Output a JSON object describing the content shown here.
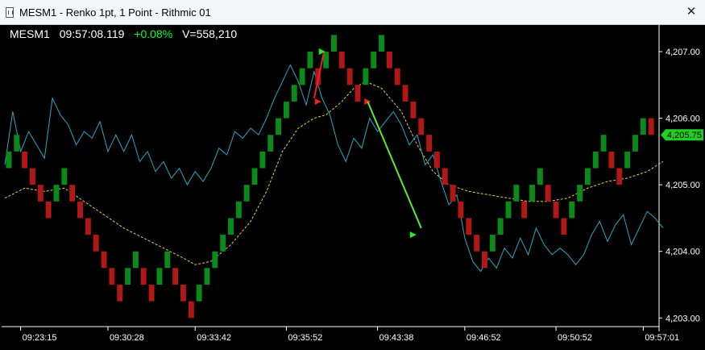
{
  "window": {
    "title": "MESM1 - Renko 1pt, 1 Point - Rithmic 01",
    "close_icon": "close-icon",
    "close_glyph": "✕"
  },
  "info": {
    "symbol": "MESM1",
    "time": "09:57:08.119",
    "change": "+0.08%",
    "volume": "V=558,210"
  },
  "colors": {
    "up": "#0a8a1a",
    "down": "#b01717",
    "fast_line": "#2aa6c4",
    "slow_line": "#e8d33a",
    "arrow_green": "#22ee22",
    "arrow_red": "#ee2222",
    "trend_line": "#55ee33",
    "last_price_bg": "#22cc22",
    "axis": "#ffffff"
  },
  "chart_data": {
    "type": "renko",
    "y_axis": {
      "ylim": [
        4202.87,
        4207.4
      ],
      "ticks": [
        "4,203.00",
        "4,204.00",
        "4,205.00",
        "4,206.00",
        "4,207.00"
      ],
      "tick_values": [
        4203,
        4204,
        4205,
        4206,
        4207
      ]
    },
    "x_axis": {
      "xlim": [
        0,
        165
      ],
      "ticks": [
        "09:23:15",
        "09:30:28",
        "09:33:42",
        "09:35:52",
        "09:43:38",
        "09:46:52",
        "09:50:52",
        "09:57:01"
      ],
      "tick_positions": [
        4,
        26,
        48,
        71,
        94,
        116,
        139,
        161
      ]
    },
    "last_price": "4,205.75",
    "last_price_value": 4205.75,
    "bricks": [
      {
        "x": 1,
        "lo": 4205.25,
        "up": true
      },
      {
        "x": 3,
        "lo": 4205.5,
        "up": true
      },
      {
        "x": 5,
        "lo": 4205.25,
        "up": false
      },
      {
        "x": 7,
        "lo": 4205.0,
        "up": false
      },
      {
        "x": 9,
        "lo": 4204.75,
        "up": false
      },
      {
        "x": 11,
        "lo": 4204.5,
        "up": false
      },
      {
        "x": 13,
        "lo": 4204.75,
        "up": true
      },
      {
        "x": 15,
        "lo": 4205.0,
        "up": true
      },
      {
        "x": 17,
        "lo": 4204.75,
        "up": false
      },
      {
        "x": 19,
        "lo": 4204.5,
        "up": false
      },
      {
        "x": 21,
        "lo": 4204.25,
        "up": false
      },
      {
        "x": 23,
        "lo": 4204.0,
        "up": false
      },
      {
        "x": 25,
        "lo": 4203.75,
        "up": false
      },
      {
        "x": 27,
        "lo": 4203.5,
        "up": false
      },
      {
        "x": 29,
        "lo": 4203.25,
        "up": false
      },
      {
        "x": 31,
        "lo": 4203.5,
        "up": true
      },
      {
        "x": 33,
        "lo": 4203.75,
        "up": true
      },
      {
        "x": 35,
        "lo": 4203.5,
        "up": false
      },
      {
        "x": 37,
        "lo": 4203.25,
        "up": false
      },
      {
        "x": 39,
        "lo": 4203.5,
        "up": true
      },
      {
        "x": 41,
        "lo": 4203.75,
        "up": true
      },
      {
        "x": 43,
        "lo": 4203.5,
        "up": false
      },
      {
        "x": 45,
        "lo": 4203.25,
        "up": false
      },
      {
        "x": 47,
        "lo": 4203.0,
        "up": false
      },
      {
        "x": 49,
        "lo": 4203.25,
        "up": true
      },
      {
        "x": 51,
        "lo": 4203.5,
        "up": true
      },
      {
        "x": 53,
        "lo": 4203.75,
        "up": true
      },
      {
        "x": 55,
        "lo": 4204.0,
        "up": true
      },
      {
        "x": 57,
        "lo": 4204.25,
        "up": true
      },
      {
        "x": 59,
        "lo": 4204.5,
        "up": true
      },
      {
        "x": 61,
        "lo": 4204.75,
        "up": true
      },
      {
        "x": 63,
        "lo": 4205.0,
        "up": true
      },
      {
        "x": 65,
        "lo": 4205.25,
        "up": true
      },
      {
        "x": 67,
        "lo": 4205.5,
        "up": true
      },
      {
        "x": 69,
        "lo": 4205.75,
        "up": true
      },
      {
        "x": 71,
        "lo": 4206.0,
        "up": true
      },
      {
        "x": 73,
        "lo": 4206.25,
        "up": true
      },
      {
        "x": 75,
        "lo": 4206.5,
        "up": true
      },
      {
        "x": 77,
        "lo": 4206.75,
        "up": true
      },
      {
        "x": 79,
        "lo": 4206.5,
        "up": false
      },
      {
        "x": 81,
        "lo": 4206.75,
        "up": true
      },
      {
        "x": 83,
        "lo": 4207.0,
        "up": true
      },
      {
        "x": 85,
        "lo": 4206.75,
        "up": false
      },
      {
        "x": 87,
        "lo": 4206.5,
        "up": false
      },
      {
        "x": 89,
        "lo": 4206.25,
        "up": false
      },
      {
        "x": 91,
        "lo": 4206.5,
        "up": true
      },
      {
        "x": 93,
        "lo": 4206.75,
        "up": true
      },
      {
        "x": 95,
        "lo": 4207.0,
        "up": true
      },
      {
        "x": 97,
        "lo": 4206.75,
        "up": false
      },
      {
        "x": 99,
        "lo": 4206.5,
        "up": false
      },
      {
        "x": 101,
        "lo": 4206.25,
        "up": false
      },
      {
        "x": 103,
        "lo": 4206.0,
        "up": false
      },
      {
        "x": 105,
        "lo": 4205.75,
        "up": false
      },
      {
        "x": 107,
        "lo": 4205.5,
        "up": false
      },
      {
        "x": 109,
        "lo": 4205.25,
        "up": false
      },
      {
        "x": 111,
        "lo": 4205.0,
        "up": false
      },
      {
        "x": 113,
        "lo": 4204.75,
        "up": false
      },
      {
        "x": 115,
        "lo": 4204.5,
        "up": false
      },
      {
        "x": 117,
        "lo": 4204.25,
        "up": false
      },
      {
        "x": 119,
        "lo": 4204.0,
        "up": false
      },
      {
        "x": 121,
        "lo": 4203.75,
        "up": false
      },
      {
        "x": 123,
        "lo": 4204.0,
        "up": true
      },
      {
        "x": 125,
        "lo": 4204.25,
        "up": true
      },
      {
        "x": 127,
        "lo": 4204.5,
        "up": true
      },
      {
        "x": 129,
        "lo": 4204.75,
        "up": true
      },
      {
        "x": 131,
        "lo": 4204.5,
        "up": false
      },
      {
        "x": 133,
        "lo": 4204.75,
        "up": true
      },
      {
        "x": 135,
        "lo": 4205.0,
        "up": true
      },
      {
        "x": 137,
        "lo": 4204.75,
        "up": false
      },
      {
        "x": 139,
        "lo": 4204.5,
        "up": false
      },
      {
        "x": 141,
        "lo": 4204.25,
        "up": false
      },
      {
        "x": 143,
        "lo": 4204.5,
        "up": true
      },
      {
        "x": 145,
        "lo": 4204.75,
        "up": true
      },
      {
        "x": 147,
        "lo": 4205.0,
        "up": true
      },
      {
        "x": 149,
        "lo": 4205.25,
        "up": true
      },
      {
        "x": 151,
        "lo": 4205.5,
        "up": true
      },
      {
        "x": 153,
        "lo": 4205.25,
        "up": false
      },
      {
        "x": 155,
        "lo": 4205.0,
        "up": false
      },
      {
        "x": 157,
        "lo": 4205.25,
        "up": true
      },
      {
        "x": 159,
        "lo": 4205.5,
        "up": true
      },
      {
        "x": 161,
        "lo": 4205.75,
        "up": true
      },
      {
        "x": 163,
        "lo": 4205.75,
        "up": false
      }
    ],
    "fast_ma": [
      [
        0,
        4205.3
      ],
      [
        2,
        4206.1
      ],
      [
        4,
        4205.5
      ],
      [
        6,
        4205.8
      ],
      [
        8,
        4205.6
      ],
      [
        10,
        4205.4
      ],
      [
        12,
        4206.3
      ],
      [
        14,
        4206.05
      ],
      [
        16,
        4205.9
      ],
      [
        18,
        4205.6
      ],
      [
        20,
        4205.8
      ],
      [
        22,
        4205.7
      ],
      [
        24,
        4205.95
      ],
      [
        26,
        4205.5
      ],
      [
        28,
        4205.75
      ],
      [
        30,
        4205.5
      ],
      [
        32,
        4205.75
      ],
      [
        34,
        4205.35
      ],
      [
        36,
        4205.5
      ],
      [
        38,
        4205.2
      ],
      [
        40,
        4205.35
      ],
      [
        42,
        4205.1
      ],
      [
        44,
        4205.25
      ],
      [
        46,
        4205.0
      ],
      [
        48,
        4205.2
      ],
      [
        50,
        4205.05
      ],
      [
        52,
        4205.25
      ],
      [
        54,
        4205.55
      ],
      [
        56,
        4205.45
      ],
      [
        58,
        4205.8
      ],
      [
        60,
        4205.7
      ],
      [
        62,
        4205.85
      ],
      [
        64,
        4205.75
      ],
      [
        66,
        4206.0
      ],
      [
        68,
        4206.3
      ],
      [
        70,
        4206.55
      ],
      [
        72,
        4206.8
      ],
      [
        74,
        4206.55
      ],
      [
        76,
        4206.2
      ],
      [
        78,
        4206.7
      ],
      [
        80,
        4206.3
      ],
      [
        82,
        4206.05
      ],
      [
        84,
        4205.6
      ],
      [
        86,
        4205.35
      ],
      [
        88,
        4205.7
      ],
      [
        90,
        4205.55
      ],
      [
        92,
        4206.0
      ],
      [
        94,
        4205.8
      ],
      [
        96,
        4205.95
      ],
      [
        98,
        4206.1
      ],
      [
        100,
        4205.9
      ],
      [
        102,
        4205.6
      ],
      [
        104,
        4205.75
      ],
      [
        106,
        4205.3
      ],
      [
        108,
        4205.45
      ],
      [
        110,
        4205.05
      ],
      [
        112,
        4204.7
      ],
      [
        114,
        4204.85
      ],
      [
        116,
        4204.2
      ],
      [
        118,
        4203.85
      ],
      [
        120,
        4203.7
      ],
      [
        122,
        4203.9
      ],
      [
        124,
        4203.75
      ],
      [
        126,
        4204.05
      ],
      [
        128,
        4203.9
      ],
      [
        130,
        4204.2
      ],
      [
        132,
        4203.95
      ],
      [
        134,
        4204.35
      ],
      [
        136,
        4204.1
      ],
      [
        138,
        4203.95
      ],
      [
        140,
        4204.05
      ],
      [
        142,
        4203.95
      ],
      [
        144,
        4203.8
      ],
      [
        146,
        4203.95
      ],
      [
        148,
        4204.25
      ],
      [
        150,
        4204.45
      ],
      [
        152,
        4204.15
      ],
      [
        154,
        4204.4
      ],
      [
        156,
        4204.55
      ],
      [
        158,
        4204.1
      ],
      [
        160,
        4204.35
      ],
      [
        162,
        4204.6
      ],
      [
        164,
        4204.5
      ],
      [
        166,
        4204.35
      ]
    ],
    "slow_ma": [
      [
        0,
        4204.8
      ],
      [
        5,
        4204.95
      ],
      [
        10,
        4204.9
      ],
      [
        15,
        4204.95
      ],
      [
        20,
        4204.75
      ],
      [
        25,
        4204.55
      ],
      [
        30,
        4204.35
      ],
      [
        35,
        4204.2
      ],
      [
        40,
        4204.05
      ],
      [
        45,
        4203.9
      ],
      [
        48,
        4203.8
      ],
      [
        52,
        4203.85
      ],
      [
        57,
        4204.1
      ],
      [
        62,
        4204.45
      ],
      [
        66,
        4204.9
      ],
      [
        70,
        4205.5
      ],
      [
        74,
        4205.85
      ],
      [
        78,
        4206.0
      ],
      [
        81,
        4206.05
      ],
      [
        85,
        4206.25
      ],
      [
        88,
        4206.45
      ],
      [
        91,
        4206.55
      ],
      [
        95,
        4206.45
      ],
      [
        100,
        4206.1
      ],
      [
        104,
        4205.6
      ],
      [
        108,
        4205.2
      ],
      [
        112,
        4205.0
      ],
      [
        117,
        4204.9
      ],
      [
        122,
        4204.85
      ],
      [
        127,
        4204.8
      ],
      [
        132,
        4204.75
      ],
      [
        137,
        4204.75
      ],
      [
        142,
        4204.8
      ],
      [
        147,
        4204.95
      ],
      [
        152,
        4205.05
      ],
      [
        157,
        4205.1
      ],
      [
        162,
        4205.2
      ],
      [
        166,
        4205.35
      ]
    ],
    "annotations": [
      {
        "type": "arrow",
        "color": "arrow_red",
        "x1": 80.5,
        "y1": 4207.0,
        "x2": 78,
        "y2": 4206.3
      },
      {
        "type": "triangle",
        "color": "arrow_green",
        "x": 80,
        "y": 4207.0
      },
      {
        "type": "triangle",
        "color": "arrow_red",
        "x": 79,
        "y": 4206.25
      },
      {
        "type": "triangle",
        "color": "arrow_red",
        "x": 91.5,
        "y": 4206.25
      },
      {
        "type": "line",
        "color": "trend_line",
        "x1": 91.5,
        "y1": 4206.25,
        "x2": 105,
        "y2": 4204.35
      },
      {
        "type": "triangle",
        "color": "arrow_green",
        "x": 103,
        "y": 4204.25
      }
    ]
  }
}
